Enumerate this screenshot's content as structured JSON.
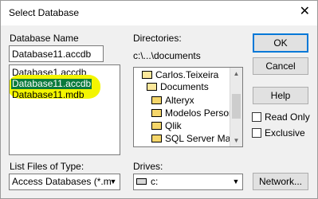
{
  "window": {
    "title": "Select Database",
    "close_symbol": "✕"
  },
  "database_name": {
    "label": "Database Name",
    "value": "Database11.accdb",
    "files": [
      "Database1.accdb",
      "Database11.accdb",
      "Database11.mdb"
    ],
    "selected_index": 1
  },
  "directories": {
    "label": "Directories:",
    "path": "c:\\...\\documents",
    "items": [
      "Carlos.Teixeira",
      "Documents",
      "Alteryx",
      "Modelos Persona",
      "Qlik",
      "SQL Server Man"
    ]
  },
  "buttons": {
    "ok": "OK",
    "cancel": "Cancel",
    "help": "Help",
    "network": "Network..."
  },
  "options": {
    "read_only": "Read Only",
    "exclusive": "Exclusive"
  },
  "file_types": {
    "label": "List Files of Type:",
    "value": "Access Databases (*.m"
  },
  "drives": {
    "label": "Drives:",
    "value": "c:"
  },
  "colors": {
    "selection": "#0a7a3c",
    "highlight": "#f3f500",
    "default_button_border": "#0078d7"
  }
}
